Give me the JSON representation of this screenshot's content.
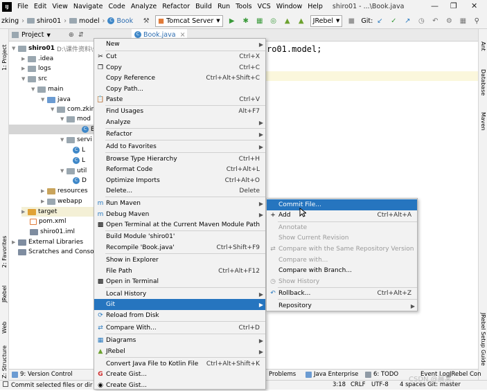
{
  "menubar": {
    "items": [
      "File",
      "Edit",
      "View",
      "Navigate",
      "Code",
      "Analyze",
      "Refactor",
      "Build",
      "Run",
      "Tools",
      "VCS",
      "Window",
      "Help"
    ],
    "title": "shiro01 - ...\\Book.java"
  },
  "toolbar": {
    "breadcrumbs": [
      "zking",
      "shiro01",
      "model",
      "Book"
    ],
    "run_config": "Tomcat Server",
    "jrebel": "JRebel",
    "git_label": "Git:"
  },
  "project_panel": {
    "title": "Project",
    "tree": [
      {
        "label": "shiro01",
        "extra": "D:\\课件资料\\v",
        "bold": true
      },
      {
        "label": ".idea"
      },
      {
        "label": "logs"
      },
      {
        "label": "src"
      },
      {
        "label": "main"
      },
      {
        "label": "java"
      },
      {
        "label": "com.zkin"
      },
      {
        "label": "mod"
      },
      {
        "label": "B"
      },
      {
        "label": "servi"
      },
      {
        "label": "L"
      },
      {
        "label": "L"
      },
      {
        "label": "util"
      },
      {
        "label": "D"
      },
      {
        "label": "resources"
      },
      {
        "label": "webapp"
      },
      {
        "label": "target"
      },
      {
        "label": "pom.xml"
      },
      {
        "label": "shiro01.iml"
      },
      {
        "label": "External Libraries"
      },
      {
        "label": "Scratches and Consol"
      }
    ]
  },
  "editor": {
    "tab": "Book.java",
    "code_fragment": "ro01.model;"
  },
  "left_strip": {
    "project": "1: Project",
    "favorites": "2: Favorites",
    "jrebel": "JRebel",
    "web": "Web",
    "structure": "Z: Structure"
  },
  "right_strip": {
    "ant": "Ant",
    "database": "Database",
    "maven": "Maven",
    "jrebel_guide": "JRebel Setup Guide"
  },
  "context_menu": {
    "items": [
      {
        "label": "New",
        "submenu": true
      },
      {
        "label": "Cut",
        "shortcut": "Ctrl+X",
        "icon": "cut-icon"
      },
      {
        "label": "Copy",
        "shortcut": "Ctrl+C",
        "icon": "copy-icon"
      },
      {
        "label": "Copy Reference",
        "shortcut": "Ctrl+Alt+Shift+C"
      },
      {
        "label": "Copy Path..."
      },
      {
        "label": "Paste",
        "shortcut": "Ctrl+V",
        "icon": "paste-icon"
      },
      {
        "label": "Find Usages",
        "shortcut": "Alt+F7"
      },
      {
        "label": "Analyze",
        "submenu": true
      },
      {
        "label": "Refactor",
        "submenu": true
      },
      {
        "label": "Add to Favorites",
        "submenu": true
      },
      {
        "label": "Browse Type Hierarchy",
        "shortcut": "Ctrl+H"
      },
      {
        "label": "Reformat Code",
        "shortcut": "Ctrl+Alt+L"
      },
      {
        "label": "Optimize Imports",
        "shortcut": "Ctrl+Alt+O"
      },
      {
        "label": "Delete...",
        "shortcut": "Delete"
      },
      {
        "label": "Run Maven",
        "submenu": true,
        "icon": "maven-icon"
      },
      {
        "label": "Debug Maven",
        "submenu": true,
        "icon": "maven-icon"
      },
      {
        "label": "Open Terminal at the Current Maven Module Path",
        "icon": "terminal-icon"
      },
      {
        "label": "Build Module 'shiro01'"
      },
      {
        "label": "Recompile 'Book.java'",
        "shortcut": "Ctrl+Shift+F9"
      },
      {
        "label": "Show in Explorer"
      },
      {
        "label": "File Path",
        "shortcut": "Ctrl+Alt+F12"
      },
      {
        "label": "Open in Terminal",
        "icon": "terminal-icon"
      },
      {
        "label": "Local History",
        "submenu": true
      },
      {
        "label": "Git",
        "submenu": true
      },
      {
        "label": "Reload from Disk",
        "icon": "reload-icon"
      },
      {
        "label": "Compare With...",
        "shortcut": "Ctrl+D",
        "icon": "compare-icon"
      },
      {
        "label": "Diagrams",
        "submenu": true,
        "icon": "diagram-icon"
      },
      {
        "label": "JRebel",
        "submenu": true,
        "icon": "jrebel-icon"
      },
      {
        "label": "Convert Java File to Kotlin File",
        "shortcut": "Ctrl+Alt+Shift+K"
      },
      {
        "label": "Create Gist...",
        "icon": "gist-icon"
      },
      {
        "label": "Create Gist...",
        "icon": "github-icon"
      }
    ]
  },
  "git_submenu": {
    "items": [
      {
        "label": "Commit File..."
      },
      {
        "label": "Add",
        "shortcut": "Ctrl+Alt+A"
      },
      {
        "label": "Annotate",
        "disabled": true
      },
      {
        "label": "Show Current Revision",
        "disabled": true
      },
      {
        "label": "Compare with the Same Repository Version",
        "disabled": true
      },
      {
        "label": "Compare with...",
        "disabled": true
      },
      {
        "label": "Compare with Branch..."
      },
      {
        "label": "Show History",
        "disabled": true
      },
      {
        "label": "Rollback...",
        "shortcut": "Ctrl+Alt+Z"
      },
      {
        "label": "Repository",
        "submenu": true
      }
    ]
  },
  "tool_windows": {
    "version_control": "9: Version Control",
    "problems": "Problems",
    "java_enterprise": "Java Enterprise",
    "todo": "6: TODO",
    "event_log": "Event Log",
    "jrebel_console": "JRebel Con"
  },
  "status_bar": {
    "message": "Commit selected files or dir",
    "position": "3:18",
    "line_sep": "CRLF",
    "encoding": "UTF-8",
    "indent": "4 spaces",
    "branch": "Git: master"
  },
  "watermark": "CSDN @晨某、",
  "colors": {
    "highlight": "#2675bf",
    "menu_bg": "#f2f2f2"
  }
}
